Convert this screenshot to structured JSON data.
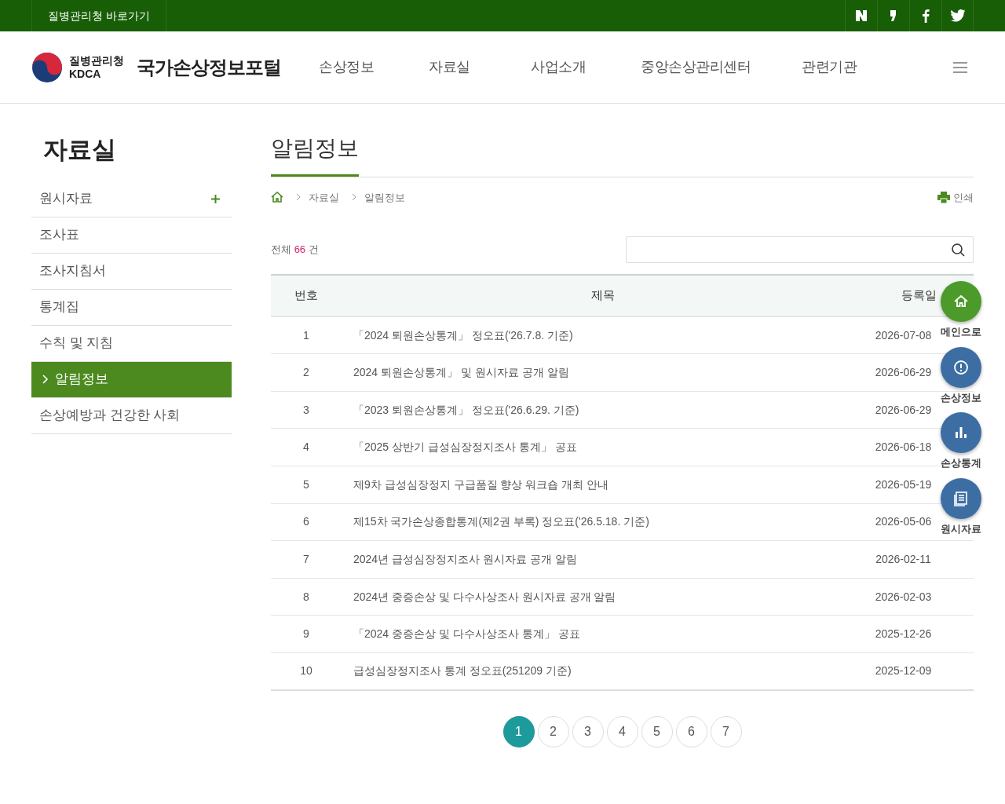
{
  "top_bar": {
    "link": "질병관리청 바로가기"
  },
  "header": {
    "agency": "질병관리청",
    "agency_en": "KDCA",
    "site_title": "국가손상정보포털",
    "nav": [
      "손상정보",
      "자료실",
      "사업소개",
      "중앙손상관리센터",
      "관련기관"
    ]
  },
  "sidebar": {
    "title": "자료실",
    "items": [
      {
        "label": "원시자료",
        "selected": false,
        "expandable": true
      },
      {
        "label": "조사표",
        "selected": false,
        "expandable": false
      },
      {
        "label": "조사지침서",
        "selected": false,
        "expandable": false
      },
      {
        "label": "통계집",
        "selected": false,
        "expandable": false
      },
      {
        "label": "수칙 및 지침",
        "selected": false,
        "expandable": false
      },
      {
        "label": "알림정보",
        "selected": true,
        "expandable": false
      },
      {
        "label": "손상예방과 건강한 사회",
        "selected": false,
        "expandable": false
      }
    ]
  },
  "content": {
    "title": "알림정보",
    "breadcrumb": [
      "자료실",
      "알림정보"
    ],
    "print": "인쇄",
    "total": {
      "prefix": "전체",
      "count": "66",
      "suffix": "건"
    },
    "table": {
      "columns": [
        "번호",
        "제목",
        "등록일"
      ],
      "rows": [
        [
          "1",
          "「2024 퇴원손상통계」 정오표('26.7.8. 기준)",
          "2026-07-08"
        ],
        [
          "2",
          "2024 퇴원손상통계」 및 원시자료 공개 알림",
          "2026-06-29"
        ],
        [
          "3",
          "「2023 퇴원손상통계」 정오표('26.6.29. 기준)",
          "2026-06-29"
        ],
        [
          "4",
          "「2025 상반기 급성심장정지조사 통계」 공표",
          "2026-06-18"
        ],
        [
          "5",
          "제9차 급성심장정지 구급품질 향상 워크숍 개최 안내",
          "2026-05-19"
        ],
        [
          "6",
          "제15차 국가손상종합통계(제2권 부록) 정오표('26.5.18. 기준)",
          "2026-05-06"
        ],
        [
          "7",
          "2024년 급성심장정지조사 원시자료 공개 알림",
          "2026-02-11"
        ],
        [
          "8",
          "2024년 중증손상 및 다수사상조사 원시자료 공개 알림",
          "2026-02-03"
        ],
        [
          "9",
          "「2024 중증손상 및 다수사상조사 통계」 공표",
          "2025-12-26"
        ],
        [
          "10",
          "급성심장정지조사 통계 정오표(251209 기준)",
          "2025-12-09"
        ]
      ]
    },
    "pagination": [
      {
        "label": "1",
        "selected": true
      },
      {
        "label": "2",
        "selected": false
      },
      {
        "label": "3",
        "selected": false
      },
      {
        "label": "4",
        "selected": false
      },
      {
        "label": "5",
        "selected": false
      },
      {
        "label": "6",
        "selected": false
      },
      {
        "label": "7",
        "selected": false
      }
    ]
  },
  "quick_menu": [
    {
      "label": "메인으로",
      "kind": "home"
    },
    {
      "label": "손상정보",
      "kind": "info"
    },
    {
      "label": "손상통계",
      "kind": "stats"
    },
    {
      "label": "원시자료",
      "kind": "data"
    }
  ]
}
